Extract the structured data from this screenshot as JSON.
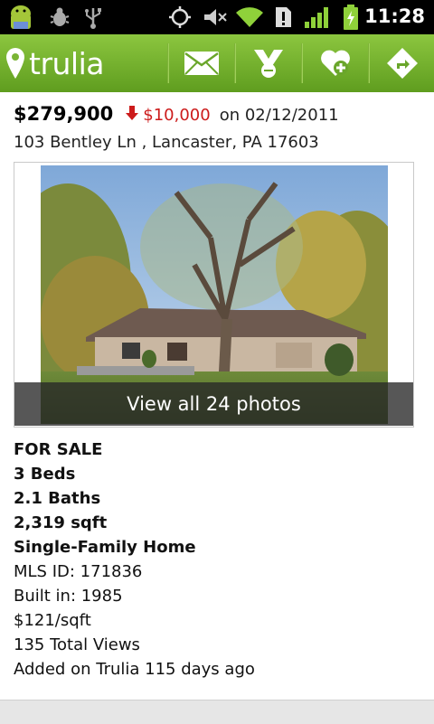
{
  "status_bar": {
    "time": "11:28",
    "icons": [
      "android-icon",
      "bug-icon",
      "usb-icon",
      "gps-icon",
      "mute-icon",
      "wifi-icon",
      "alert-icon",
      "signal-icon",
      "battery-icon"
    ]
  },
  "app_bar": {
    "logo": "trulia",
    "actions": [
      "email-icon",
      "contact-agent-icon",
      "favorite-add-icon",
      "share-icon"
    ],
    "color": "#7ab535"
  },
  "listing": {
    "price": "$279,900",
    "price_drop": "$10,000",
    "date_text": "on 02/12/2011",
    "address": "103 Bentley Ln , Lancaster, PA 17603",
    "photo_cta": "View all 24 photos",
    "status": "FOR SALE",
    "beds": "3 Beds",
    "baths": "2.1 Baths",
    "sqft": "2,319 sqft",
    "type": "Single-Family Home",
    "mls": "MLS ID: 171836",
    "built": "Built in: 1985",
    "price_per_sqft": "$121/sqft",
    "views": "135 Total Views",
    "added": "Added on Trulia 115 days ago"
  },
  "colors": {
    "drop": "#cc1b1b",
    "accent": "#7ab535"
  }
}
